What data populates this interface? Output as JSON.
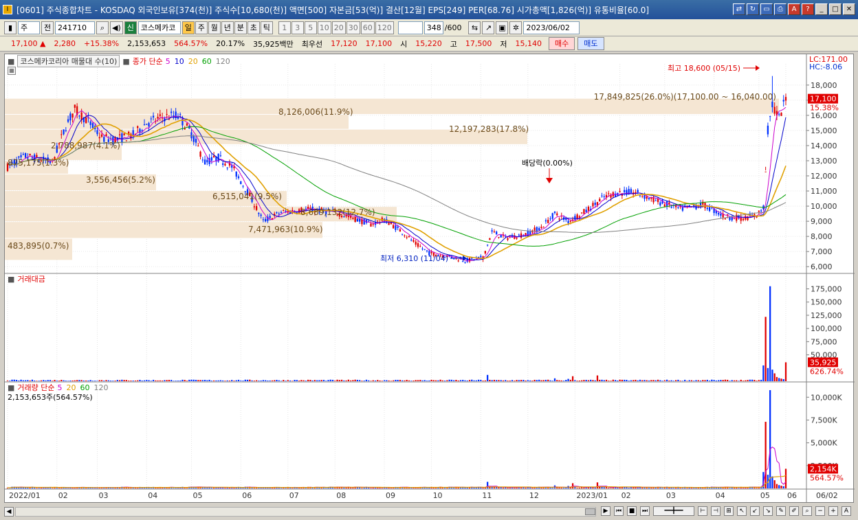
{
  "window": {
    "title": "[0601] 주식종합차트 - KOSDAQ 외국인보유[374(천)] 주식수[10,680(천)] 액면[500] 자본금[53(억)] 결산[12월] EPS[249] PER[68.76] 시가총액[1,826(억)] 유통비율[60.0]",
    "app_icon": "I"
  },
  "toolbar": {
    "period": "주",
    "prev_label": "전",
    "code": "241710",
    "name_tag": "신",
    "name": "코스메카코",
    "periods": [
      "일",
      "주",
      "월",
      "년",
      "분",
      "초",
      "틱"
    ],
    "active_period": "일",
    "numbers": [
      "1",
      "3",
      "5",
      "10",
      "20",
      "30",
      "60",
      "120"
    ],
    "count": "348",
    "count_total": "/600",
    "date": "2023/06/02"
  },
  "quote": {
    "price": "17,100",
    "change": "2,280",
    "change_pct": "+15.38%",
    "volume": "2,153,653",
    "vol_ratio": "564.57%",
    "turnover": "20.17%",
    "amount": "35,925백만",
    "best_label": "최우선",
    "ask": "17,120",
    "bid": "17,100",
    "open_label": "시",
    "open": "15,220",
    "high_label": "고",
    "high": "17,500",
    "low_label": "저",
    "low": "15,140",
    "buy": "매수",
    "sell": "매도"
  },
  "legend": {
    "name_box": "코스메카코리아 매물대 수(10)",
    "ma_title": "종가 단순",
    "ma_periods": [
      "5",
      "10",
      "20",
      "60",
      "120"
    ],
    "amount_title": "거래대금",
    "volume_title": "거래량 단순",
    "volume_ma_periods": [
      "5",
      "20",
      "60",
      "120"
    ],
    "volume_value": "2,153,653주(564.57%)"
  },
  "colors": {
    "up": "#e00000",
    "down": "#0030ff",
    "ma5": "#cc00cc",
    "ma10": "#0000cc",
    "ma20": "#e0a000",
    "ma60": "#00a000",
    "ma120": "#808080",
    "profile": "#f5e6d3"
  },
  "chart_data": {
    "type": "candlestick",
    "x_ticks": [
      "2022/01",
      "02",
      "03",
      "04",
      "05",
      "06",
      "07",
      "08",
      "09",
      "10",
      "11",
      "12",
      "2023/01",
      "02",
      "03",
      "04",
      "05",
      "06"
    ],
    "x_last": "06/02",
    "price_axis": {
      "ticks": [
        "6,000",
        "7,000",
        "8,000",
        "9,000",
        "10,000",
        "11,000",
        "12,000",
        "13,000",
        "14,000",
        "15,000",
        "16,000",
        "17,000",
        "18,000"
      ],
      "range": [
        5600,
        19400
      ],
      "lc": "LC:171.00",
      "hc": "HC:-8.06",
      "last_price": "17,100",
      "last_pct": "15.38%"
    },
    "annotations": {
      "high": "최고 18,600 (05/15)",
      "low": "최저 6,310 (11/04)",
      "dividend": "배당락(0.00%)"
    },
    "volume_profile": [
      {
        "label": "17,849,825(26.0%)(17,100.00 ~ 16,040.00)",
        "value": 17849825
      },
      {
        "label": "8,126,006(11.9%)",
        "value": 8126006
      },
      {
        "label": "12,197,283(17.8%)",
        "value": 12197283
      },
      {
        "label": "2,788,987(4.1%)",
        "value": 2788987
      },
      {
        "label": "875,175(1.3%)",
        "value": 875175
      },
      {
        "label": "3,556,456(5.2%)",
        "value": 3556456
      },
      {
        "label": "6,515,041(9.5%)",
        "value": 6515041
      },
      {
        "label": "8,689,132(12.7%)",
        "value": 8689132
      },
      {
        "label": "7,471,963(10.9%)",
        "value": 7471963
      },
      {
        "label": "483,895(0.7%)",
        "value": 483895
      }
    ],
    "amount_axis": {
      "ticks": [
        "50,000",
        "75,000",
        "100,000",
        "125,000",
        "150,000",
        "175,000"
      ],
      "last_value": "35,925",
      "last_pct": "626.74%"
    },
    "volume_axis": {
      "ticks": [
        "2,500K",
        "5,000K",
        "7,500K",
        "10,000K"
      ],
      "last_value": "2,154K",
      "last_pct": "564.57%"
    }
  }
}
